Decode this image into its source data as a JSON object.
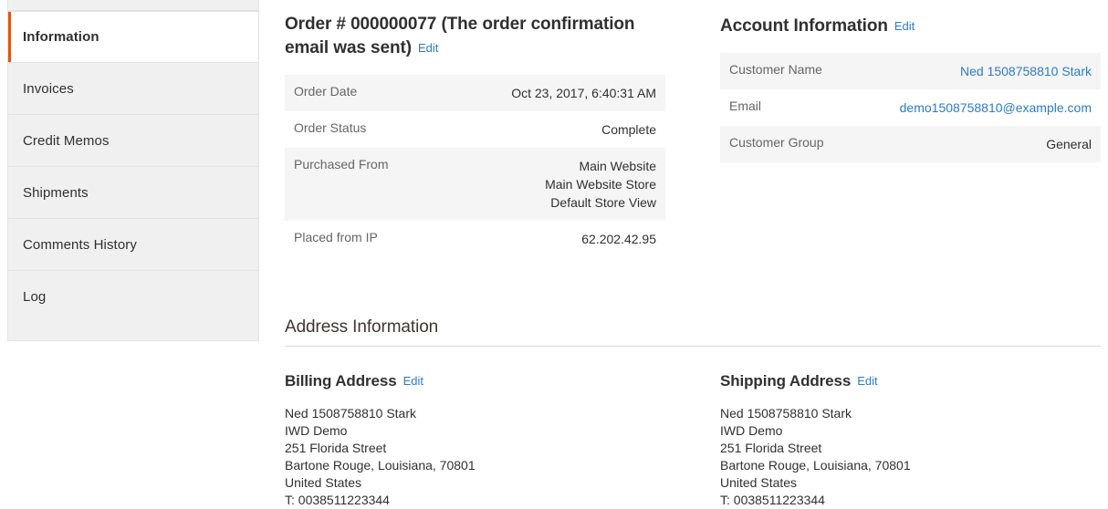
{
  "sidebar": {
    "items": [
      {
        "label": "",
        "active": false,
        "partial": true
      },
      {
        "label": "Information",
        "active": true,
        "partial": false
      },
      {
        "label": "Invoices",
        "active": false,
        "partial": false
      },
      {
        "label": "Credit Memos",
        "active": false,
        "partial": false
      },
      {
        "label": "Shipments",
        "active": false,
        "partial": false
      },
      {
        "label": "Comments History",
        "active": false,
        "partial": false
      },
      {
        "label": "Log",
        "active": false,
        "partial": false
      }
    ],
    "active_accent_color": "#eb5202"
  },
  "order_panel": {
    "title": "Order # 000000077 (The order confirmation email was sent)",
    "edit_label": "Edit",
    "rows": [
      {
        "label": "Order Date",
        "value": "Oct 23, 2017, 6:40:31 AM"
      },
      {
        "label": "Order Status",
        "value": "Complete"
      },
      {
        "label": "Purchased From",
        "value": "Main Website\nMain Website Store\nDefault Store View"
      },
      {
        "label": "Placed from IP",
        "value": "62.202.42.95"
      }
    ]
  },
  "account_panel": {
    "title": "Account Information",
    "edit_label": "Edit",
    "rows": [
      {
        "label": "Customer Name",
        "value": "Ned 1508758810 Stark",
        "link": true
      },
      {
        "label": "Email",
        "value": "demo1508758810@example.com",
        "link": true
      },
      {
        "label": "Customer Group",
        "value": "General",
        "link": false
      }
    ]
  },
  "address_section": {
    "heading": "Address Information",
    "billing": {
      "title": "Billing Address",
      "edit_label": "Edit",
      "lines": [
        "Ned 1508758810 Stark",
        "IWD Demo",
        "251 Florida Street",
        "Bartone Rouge, Louisiana, 70801",
        "United States",
        "T: 0038511223344"
      ]
    },
    "shipping": {
      "title": "Shipping Address",
      "edit_label": "Edit",
      "lines": [
        "Ned 1508758810 Stark",
        "IWD Demo",
        "251 Florida Street",
        "Bartone Rouge, Louisiana, 70801",
        "United States",
        "T: 0038511223344"
      ]
    }
  },
  "colors": {
    "link": "#2a7cc7",
    "accent": "#eb5202",
    "row_alt": "#f5f5f5",
    "heading": "#303030"
  }
}
